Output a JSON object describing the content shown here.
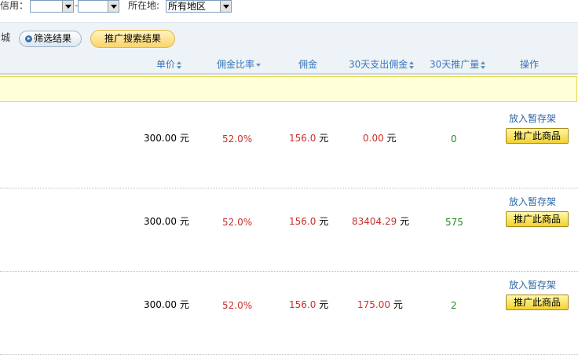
{
  "filters": {
    "credit_label": "信用：",
    "credit_from": "",
    "credit_to": "",
    "credit_separator": "-",
    "location_label": "所在地:",
    "location_value": "所有地区",
    "mall_label": "城"
  },
  "actions": {
    "filter_button": "筛选结果",
    "promote_button": "推广搜索结果"
  },
  "columns": {
    "price": "单价",
    "commission_rate": "佣金比率",
    "commission": "佣金",
    "paid_30d": "30天支出佣金",
    "promo_30d": "30天推广量",
    "operation": "操作"
  },
  "currency_unit": "元",
  "rows": [
    {
      "price": "300.00",
      "rate": "52.0%",
      "commission": "156.0",
      "paid": "0.00",
      "count": "0",
      "shelf": "放入暂存架",
      "promote": "推广此商品"
    },
    {
      "price": "300.00",
      "rate": "52.0%",
      "commission": "156.0",
      "paid": "83404.29",
      "count": "575",
      "shelf": "放入暂存架",
      "promote": "推广此商品"
    },
    {
      "price": "300.00",
      "rate": "52.0%",
      "commission": "156.0",
      "paid": "175.00",
      "count": "2",
      "shelf": "放入暂存架",
      "promote": "推广此商品"
    }
  ],
  "colors": {
    "accent_blue": "#3b77b8",
    "value_red": "#c8302a",
    "count_green": "#228b22",
    "notice_bg": "#ffffd9"
  }
}
